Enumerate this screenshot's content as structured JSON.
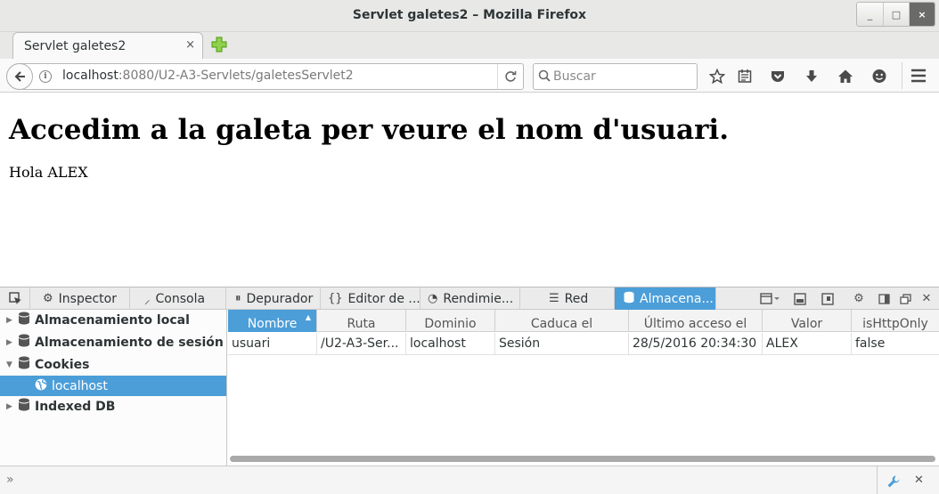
{
  "window": {
    "title": "Servlet galetes2 – Mozilla Firefox",
    "minimize": "_",
    "maximize": "□",
    "close": "×"
  },
  "tabs": [
    {
      "label": "Servlet galetes2",
      "close": "×"
    }
  ],
  "navbar": {
    "url_host": "localhost",
    "url_rest": ":8080/U2-A3-Servlets/galetesServlet2",
    "search_placeholder": "Buscar"
  },
  "page": {
    "heading": "Accedim a la galeta per veure el nom d'usuari.",
    "greeting": "Hola ALEX"
  },
  "devtools": {
    "tabs": {
      "inspector": "Inspector",
      "console": "Consola",
      "debugger": "Depurador",
      "style_editor": "Editor de ...",
      "performance": "Rendimie...",
      "network": "Red",
      "storage": "Almacena..."
    },
    "tree": {
      "local_storage": "Almacenamiento local",
      "session_storage": "Almacenamiento de sesión",
      "cookies": "Cookies",
      "localhost": "localhost",
      "indexed_db": "Indexed DB"
    },
    "table": {
      "columns": [
        "Nombre",
        "Ruta",
        "Dominio",
        "Caduca el",
        "Último acceso el",
        "Valor",
        "isHttpOnly"
      ],
      "rows": [
        [
          "usuari",
          "/U2-A3-Ser...",
          "localhost",
          "Sesión",
          "28/5/2016 20:34:30",
          "ALEX",
          "false"
        ]
      ]
    },
    "console_prompt": "»"
  },
  "colors": {
    "selection": "#4c9ed9",
    "chrome": "#e8e8e7"
  }
}
